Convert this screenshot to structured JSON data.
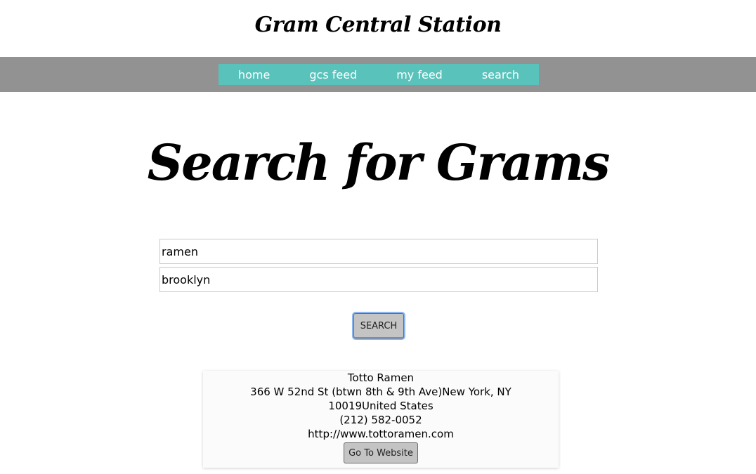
{
  "header": {
    "title": "Gram Central Station"
  },
  "nav": {
    "items": [
      {
        "label": "home"
      },
      {
        "label": "gcs feed"
      },
      {
        "label": "my feed"
      },
      {
        "label": "search"
      }
    ]
  },
  "main": {
    "heading": "Search for Grams",
    "search": {
      "term_value": "ramen",
      "location_value": "brooklyn",
      "button_label": "SEARCH"
    },
    "results": [
      {
        "name": "Totto Ramen",
        "address_line1": "366 W 52nd St (btwn 8th & 9th Ave)New York, NY",
        "address_line2": "10019United States",
        "phone": "(212) 582-0052",
        "website": "http://www.tottoramen.com",
        "button_label": "Go To Website"
      }
    ]
  },
  "colors": {
    "nav_bar": "#929292",
    "nav_inner": "#59c2bb",
    "button": "#c4c4c4",
    "focus_ring": "#8ab7f2"
  }
}
